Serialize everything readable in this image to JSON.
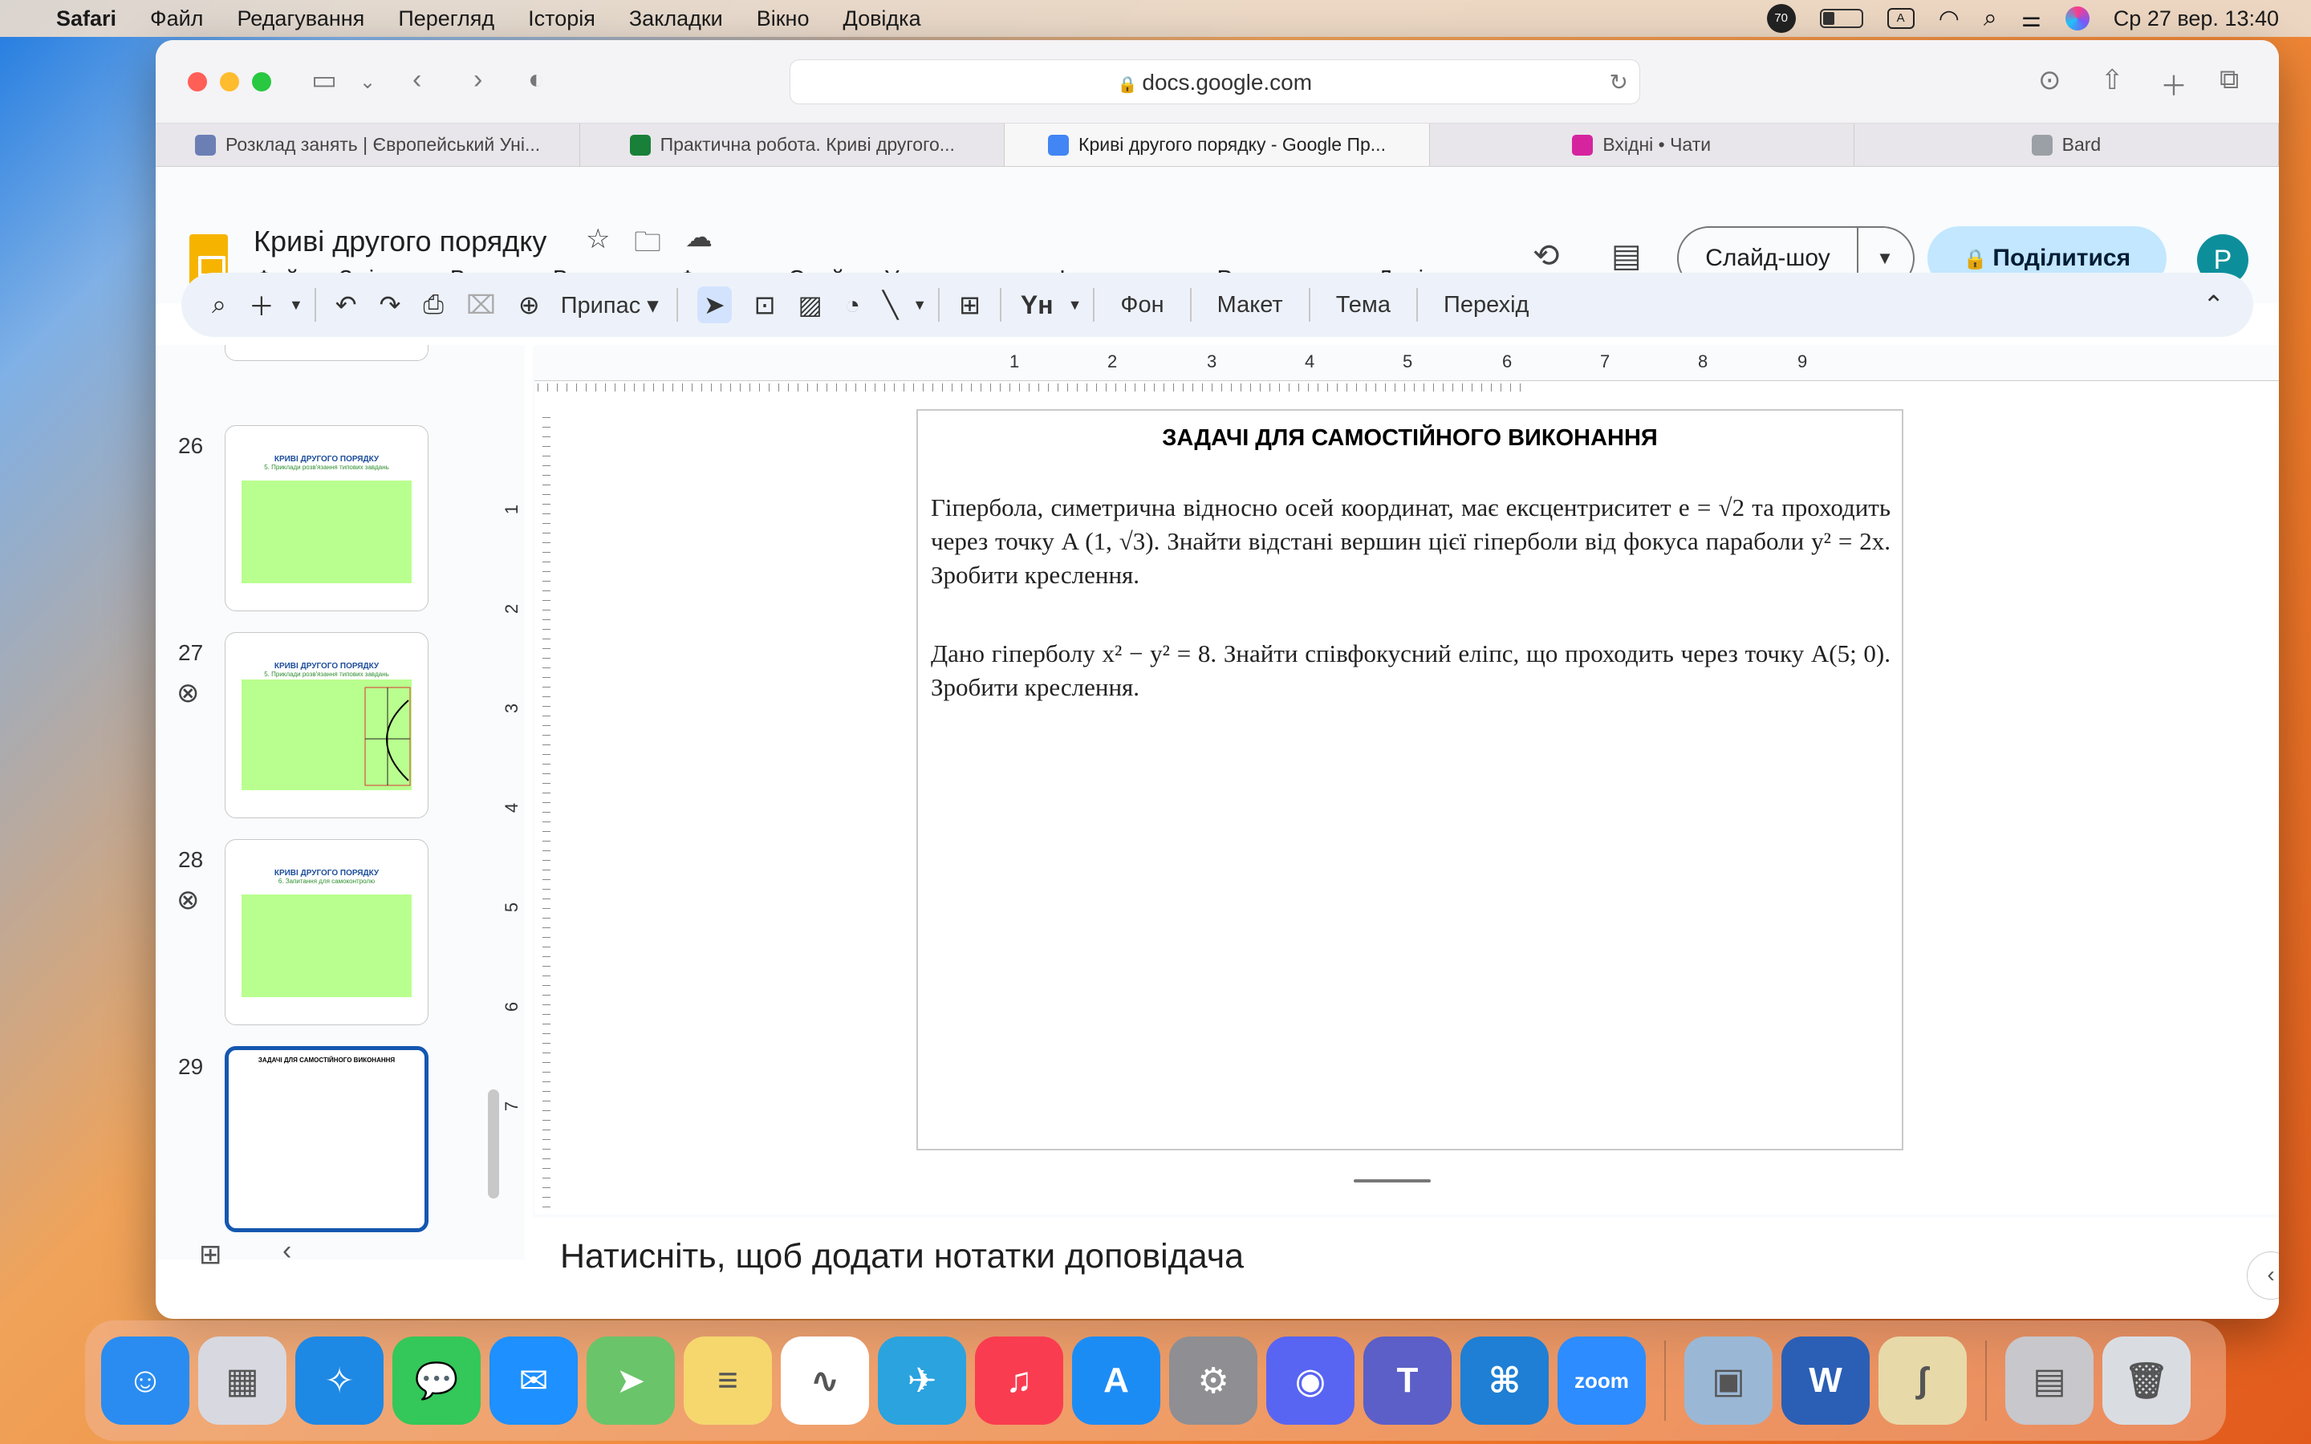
{
  "menubar": {
    "app": "Safari",
    "items": [
      "Файл",
      "Редагування",
      "Перегляд",
      "Історія",
      "Закладки",
      "Вікно",
      "Довідка"
    ],
    "battery_badge": "70",
    "input_indicator": "A",
    "datetime": "Ср 27 вер.  13:40"
  },
  "browser": {
    "url": "docs.google.com",
    "tabs": [
      {
        "label": "Розклад занять | Європейський Уні...",
        "color": "#6b7fb5"
      },
      {
        "label": "Практична робота. Криві другого...",
        "color": "#188038"
      },
      {
        "label": "Криві другого порядку - Google Пр...",
        "color": "#4285f4"
      },
      {
        "label": "Вхідні • Чати",
        "color": "#d6249f"
      },
      {
        "label": "Bard",
        "color": "#9aa0a6"
      }
    ]
  },
  "docs": {
    "title": "Криві другого порядку",
    "menus": [
      "Файл",
      "Змінити",
      "Вигляд",
      "Вставити",
      "Формат",
      "Слайд",
      "Упорядкувати",
      "Інструменти",
      "Розширення",
      "Довідка"
    ],
    "slideshow_label": "Слайд-шоу",
    "share_label": "Поділитися",
    "avatar_letter": "P"
  },
  "toolbar": {
    "zoom_label": "Припас",
    "background_label": "Фон",
    "layout_label": "Макет",
    "theme_label": "Тема",
    "transition_label": "Перехід"
  },
  "ruler": {
    "h_numbers": [
      "1",
      "2",
      "3",
      "4",
      "5",
      "6",
      "7",
      "8",
      "9"
    ],
    "v_numbers": [
      "1",
      "2",
      "3",
      "4",
      "5",
      "6",
      "7"
    ]
  },
  "thumbnails": [
    {
      "number": "26",
      "title": "КРИВІ ДРУГОГО ПОРЯДКУ",
      "subtitle": "5. Приклади розв'язання типових завдань",
      "linked": false
    },
    {
      "number": "27",
      "title": "КРИВІ ДРУГОГО ПОРЯДКУ",
      "subtitle": "5. Приклади розв'язання типових завдань",
      "linked": true
    },
    {
      "number": "28",
      "title": "КРИВІ ДРУГОГО ПОРЯДКУ",
      "subtitle": "6. Запитання для самоконтролю",
      "linked": true
    },
    {
      "number": "29",
      "title": "ЗАДАЧІ ДЛЯ САМОСТІЙНОГО ВИКОНАННЯ",
      "subtitle": "",
      "linked": false
    }
  ],
  "slide": {
    "title": "ЗАДАЧІ ДЛЯ САМОСТІЙНОГО ВИКОНАННЯ",
    "problem1": "Гіпербола, симетрична відносно осей координат, має ексцентриситет e = √2 та проходить через точку A (1, √3). Знайти відстані вершин цієї гіперболи від фокуса параболи y² = 2x. Зробити креслення.",
    "problem2": "Дано гіперболу x² − y² = 8. Знайти співфокусний еліпс, що проходить через точку A(5; 0). Зробити креслення."
  },
  "notes": {
    "placeholder": "Натисніть, щоб додати нотатки доповідача"
  },
  "dock": [
    {
      "name": "finder",
      "glyph": "☺",
      "color": "#2a8cf0"
    },
    {
      "name": "launchpad",
      "glyph": "▦",
      "color": "#d8d8e0"
    },
    {
      "name": "safari",
      "glyph": "✧",
      "color": "#1e88e5"
    },
    {
      "name": "messages",
      "glyph": "💬",
      "color": "#34c759"
    },
    {
      "name": "mail",
      "glyph": "✉",
      "color": "#1e90ff"
    },
    {
      "name": "maps",
      "glyph": "➤",
      "color": "#6ac46a"
    },
    {
      "name": "notes",
      "glyph": "≡",
      "color": "#f5d76e"
    },
    {
      "name": "freeform",
      "glyph": "∿",
      "color": "#ffffff"
    },
    {
      "name": "telegram",
      "glyph": "✈",
      "color": "#2aa3df"
    },
    {
      "name": "music",
      "glyph": "♫",
      "color": "#fa3c50"
    },
    {
      "name": "app-store",
      "glyph": "A",
      "color": "#1c8cf5"
    },
    {
      "name": "system-settings",
      "glyph": "⚙",
      "color": "#8e8e93"
    },
    {
      "name": "discord",
      "glyph": "◉",
      "color": "#5865f2"
    },
    {
      "name": "teams",
      "glyph": "T",
      "color": "#5b5fc7"
    },
    {
      "name": "vscode",
      "glyph": "⌘",
      "color": "#1e7fd4"
    },
    {
      "name": "zoom",
      "glyph": "zoom",
      "color": "#2d8cff"
    },
    {
      "name": "preview",
      "glyph": "▣",
      "color": "#9ab8d6"
    },
    {
      "name": "word",
      "glyph": "W",
      "color": "#2b5fb5"
    },
    {
      "name": "grapher",
      "glyph": "∫",
      "color": "#e8d9a8"
    },
    {
      "name": "archive-utility",
      "glyph": "▤",
      "color": "#c7c7cc"
    },
    {
      "name": "trash",
      "glyph": "🗑",
      "color": "#d9dde2"
    }
  ]
}
